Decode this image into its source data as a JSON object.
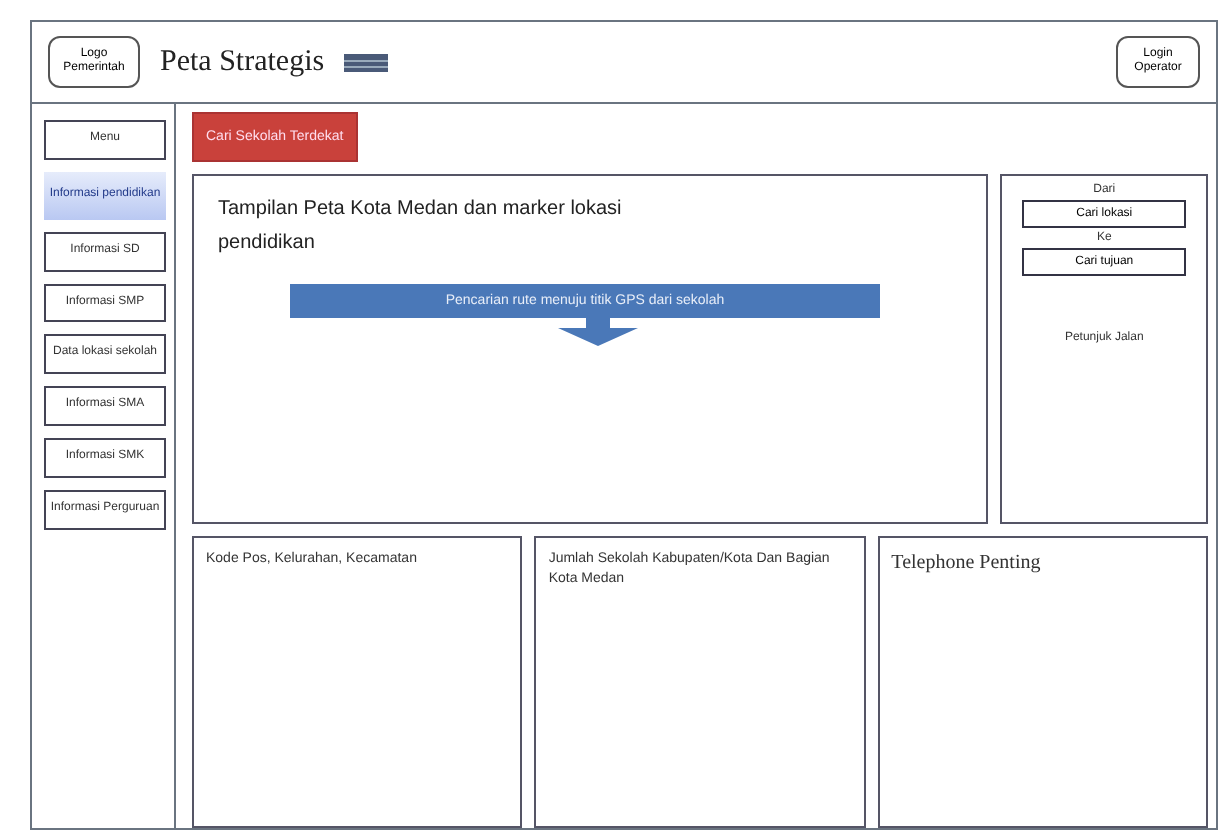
{
  "header": {
    "logo": "Logo Pemerintah",
    "title": "Peta Strategis",
    "login": "Login Operator"
  },
  "sidebar": {
    "items": [
      {
        "label": "Menu",
        "selected": false
      },
      {
        "label": "Informasi pendidikan",
        "selected": true
      },
      {
        "label": "Informasi SD",
        "selected": false
      },
      {
        "label": "Informasi SMP",
        "selected": false
      },
      {
        "label": "Data lokasi sekolah",
        "selected": false
      },
      {
        "label": "Informasi SMA",
        "selected": false
      },
      {
        "label": "Informasi SMK",
        "selected": false
      },
      {
        "label": "Informasi Perguruan",
        "selected": false
      }
    ]
  },
  "search_button": "Cari Sekolah Terdekat",
  "map": {
    "caption": "Tampilan Peta Kota Medan dan marker lokasi pendidikan",
    "banner": "Pencarian rute menuju titik GPS dari sekolah"
  },
  "route": {
    "from_label": "Dari",
    "from_value": "Cari lokasi",
    "to_label": "Ke",
    "to_value": "Cari tujuan",
    "directions": "Petunjuk Jalan"
  },
  "panels": [
    {
      "text": "Kode Pos, Kelurahan, Kecamatan"
    },
    {
      "text": "Jumlah Sekolah Kabupaten/Kota Dan Bagian Kota Medan"
    },
    {
      "text": "Telephone Penting"
    }
  ]
}
